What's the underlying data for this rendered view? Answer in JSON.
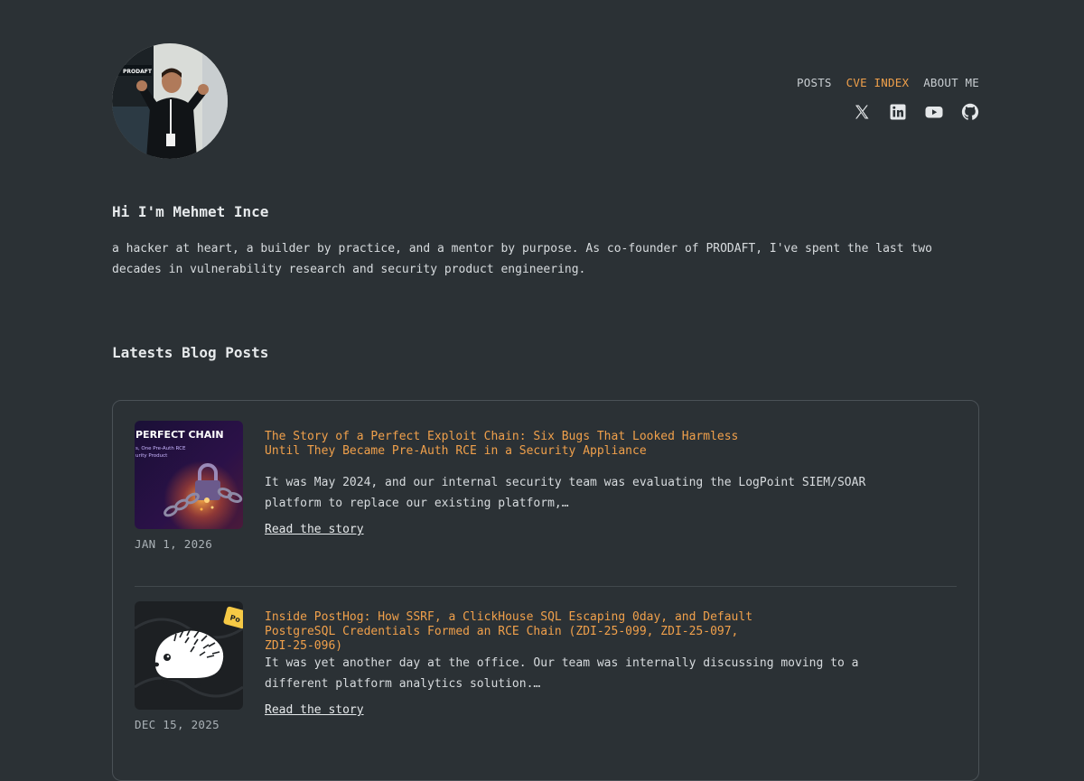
{
  "nav": {
    "items": [
      {
        "label": "POSTS"
      },
      {
        "label": "CVE INDEX"
      },
      {
        "label": "ABOUT ME"
      }
    ]
  },
  "socials": [
    "x-icon",
    "linkedin-icon",
    "youtube-icon",
    "github-icon"
  ],
  "intro": {
    "greeting": "Hi I'm Mehmet Ince",
    "bio": "a hacker at heart, a builder by practice, and a mentor by purpose. As co-founder of PRODAFT, I've spent the last two decades in vulnerability research and security product engineering."
  },
  "avatar_badge": "PRODAFT",
  "section_title": "Latests Blog Posts",
  "posts": [
    {
      "title": "The Story of a Perfect Exploit Chain: Six Bugs That Looked Harmless Until They Became Pre-Auth RCE in a Security Appliance",
      "excerpt": "It was May 2024, and our internal security team was evaluating the LogPoint SIEM/SOAR platform to replace our existing platform,…",
      "read_more": "Read the story",
      "date": "JAN 1, 2026",
      "thumb_text": {
        "headline": "PERFECT CHAIN",
        "line1": "s, One Pre-Auth RCE",
        "line2": "urity Product"
      }
    },
    {
      "title": "Inside PostHog: How SSRF, a ClickHouse SQL Escaping 0day, and Default PostgreSQL Credentials Formed an RCE Chain (ZDI-25-099, ZDI-25-097, ZDI-25-096)",
      "excerpt": "It was yet another day at the office. Our team was internally discussing moving to a different platform analytics solution.…",
      "read_more": "Read the story",
      "date": "DEC 15, 2025",
      "thumb_text": {
        "badge": "Po"
      }
    }
  ],
  "colors": {
    "background": "#2b3135",
    "accent": "#f0a04b",
    "text": "#dfe3e6",
    "border": "#4a5156"
  }
}
